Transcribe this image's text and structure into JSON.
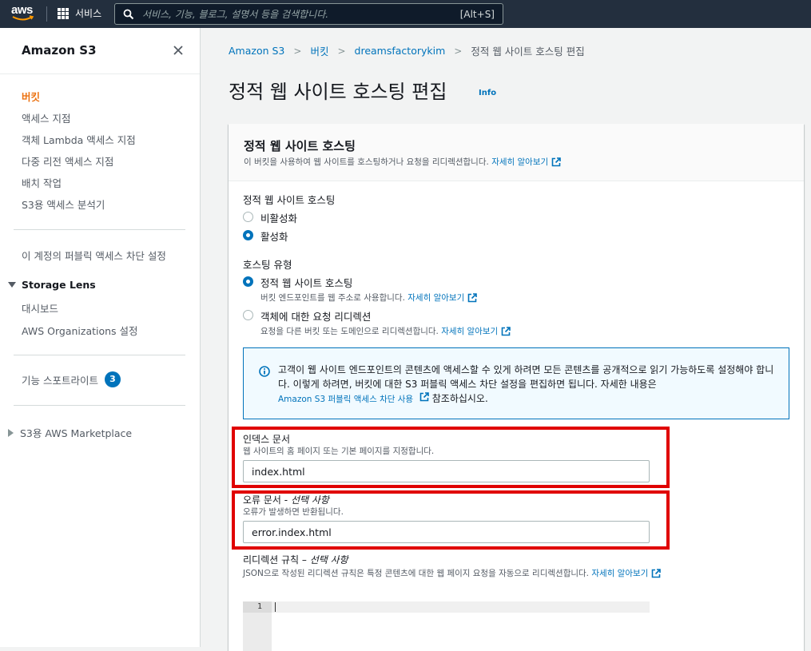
{
  "topnav": {
    "logo_text": "aws",
    "services_label": "서비스",
    "search_placeholder": "서비스, 기능, 블로그, 설명서 등을 검색합니다.",
    "search_shortcut": "[Alt+S]"
  },
  "sidebar": {
    "title": "Amazon S3",
    "items": [
      {
        "label": "버킷",
        "active": true
      },
      {
        "label": "액세스 지점"
      },
      {
        "label": "객체 Lambda 액세스 지점"
      },
      {
        "label": "다중 리전 액세스 지점"
      },
      {
        "label": "배치 작업"
      },
      {
        "label": "S3용 액세스 분석기"
      }
    ],
    "block_public_access": "이 계정의 퍼블릭 액세스 차단 설정",
    "storage_lens": {
      "title": "Storage Lens",
      "items": [
        "대시보드",
        "AWS Organizations 설정"
      ]
    },
    "feature_spotlight": {
      "label": "기능 스포트라이트",
      "count": "3"
    },
    "marketplace": "S3용 AWS Marketplace"
  },
  "breadcrumb": [
    "Amazon S3",
    "버킷",
    "dreamsfactorykim",
    "정적 웹 사이트 호스팅 편집"
  ],
  "page": {
    "title": "정적 웹 사이트 호스팅 편집",
    "info": "Info"
  },
  "panel": {
    "title": "정적 웹 사이트 호스팅",
    "description": "이 버킷을 사용하여 웹 사이트를 호스팅하거나 요청을 리디렉션합니다.",
    "learn_more": "자세히 알아보기",
    "hosting": {
      "label": "정적 웹 사이트 호스팅",
      "options": [
        "비활성화",
        "활성화"
      ],
      "selected": "활성화"
    },
    "hosting_type": {
      "label": "호스팅 유형",
      "options": [
        {
          "label": "정적 웹 사이트 호스팅",
          "description": "버킷 엔드포인트를 웹 주소로 사용합니다.",
          "link": "자세히 알아보기"
        },
        {
          "label": "객체에 대한 요청 리디렉션",
          "description": "요청을 다른 버킷 또는 도메인으로 리디렉션합니다.",
          "link": "자세히 알아보기"
        }
      ],
      "selected": "정적 웹 사이트 호스팅"
    },
    "alert": {
      "text_1": "고객이 웹 사이트 엔드포인트의 콘텐츠에 액세스할 수 있게 하려면 모든 콘텐츠를 공개적으로 읽기 가능하도록 설정해야 합니다. 이렇게 하려면, 버킷에 대한 S3 퍼블릭 액세스 차단 설정을 편집하면 됩니다. 자세한 내용은",
      "link": "Amazon S3 퍼블릭 액세스 차단 사용",
      "text_2": "참조하십시오."
    },
    "index_document": {
      "label": "인덱스 문서",
      "description": "웹 사이트의 홈 페이지 또는 기본 페이지를 지정합니다.",
      "value": "index.html"
    },
    "error_document": {
      "label": "오류 문서 - ",
      "optional": "선택 사항",
      "description": "오류가 발생하면 반환됩니다.",
      "value": "error.index.html"
    },
    "redirect_rules": {
      "label": "리디렉션 규칙 – ",
      "optional": "선택 사항",
      "description": "JSON으로 작성된 리디렉션 규칙은 특정 콘텐츠에 대한 웹 페이지 요청을 자동으로 리디렉션합니다.",
      "link": "자세히 알아보기",
      "line_number": "1"
    }
  },
  "colors": {
    "nav_bg": "#232f3e",
    "link": "#0073bb",
    "active": "#ec7211",
    "highlight_box": "#e00000"
  }
}
